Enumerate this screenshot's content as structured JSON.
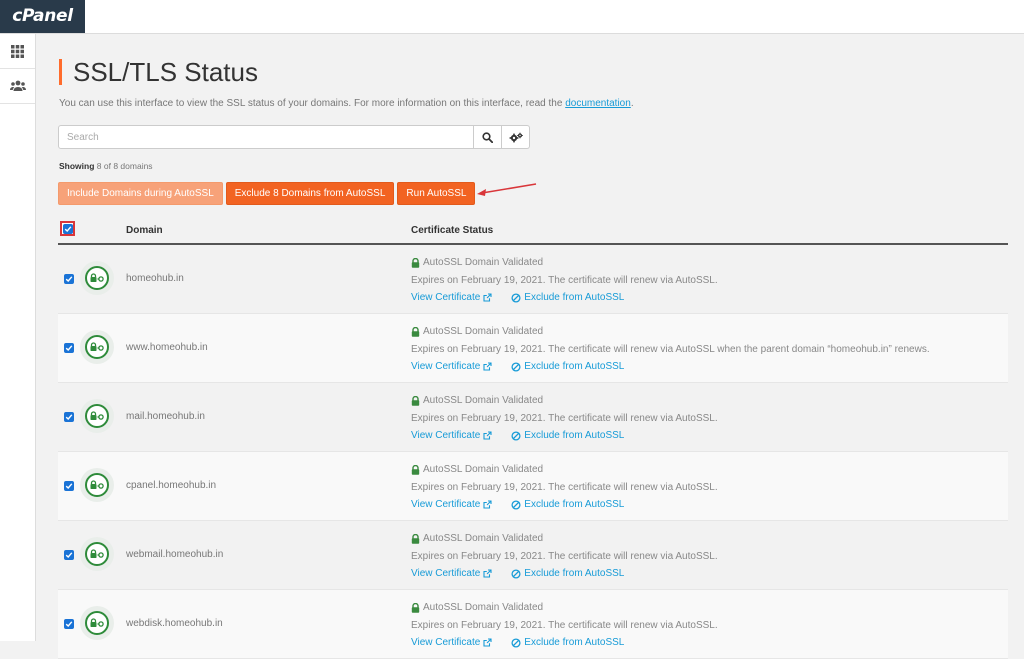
{
  "brand": {
    "logo_text": "cPanel"
  },
  "sidebar": {
    "items": [
      {
        "icon": "grid-icon"
      },
      {
        "icon": "users-icon"
      }
    ]
  },
  "page": {
    "title": "SSL/TLS Status",
    "description_prefix": "You can use this interface to view the SSL status of your domains. For more information on this interface, read the ",
    "description_link": "documentation",
    "description_suffix": "."
  },
  "search": {
    "placeholder": "Search",
    "value": ""
  },
  "showing": {
    "label": "Showing",
    "text": "8 of 8 domains"
  },
  "actions": {
    "include_label": "Include Domains during AutoSSL",
    "exclude_label": "Exclude 8 Domains from AutoSSL",
    "run_label": "Run AutoSSL"
  },
  "table": {
    "headers": {
      "domain": "Domain",
      "status": "Certificate Status"
    },
    "rows": [
      {
        "domain": "homeohub.in",
        "status": "AutoSSL Domain Validated",
        "expires": "Expires on February 19, 2021. The certificate will renew via AutoSSL.",
        "view": "View Certificate",
        "exclude": "Exclude from AutoSSL"
      },
      {
        "domain": "www.homeohub.in",
        "status": "AutoSSL Domain Validated",
        "expires": "Expires on February 19, 2021. The certificate will renew via AutoSSL when the parent domain “homeohub.in” renews.",
        "view": "View Certificate",
        "exclude": "Exclude from AutoSSL"
      },
      {
        "domain": "mail.homeohub.in",
        "status": "AutoSSL Domain Validated",
        "expires": "Expires on February 19, 2021. The certificate will renew via AutoSSL.",
        "view": "View Certificate",
        "exclude": "Exclude from AutoSSL"
      },
      {
        "domain": "cpanel.homeohub.in",
        "status": "AutoSSL Domain Validated",
        "expires": "Expires on February 19, 2021. The certificate will renew via AutoSSL.",
        "view": "View Certificate",
        "exclude": "Exclude from AutoSSL"
      },
      {
        "domain": "webmail.homeohub.in",
        "status": "AutoSSL Domain Validated",
        "expires": "Expires on February 19, 2021. The certificate will renew via AutoSSL.",
        "view": "View Certificate",
        "exclude": "Exclude from AutoSSL"
      },
      {
        "domain": "webdisk.homeohub.in",
        "status": "AutoSSL Domain Validated",
        "expires": "Expires on February 19, 2021. The certificate will renew via AutoSSL.",
        "view": "View Certificate",
        "exclude": "Exclude from AutoSSL"
      }
    ]
  },
  "colors": {
    "accent": "#ff6c2c",
    "button": "#f26322",
    "button_light": "#f7a279",
    "link": "#179bd7",
    "valid_green": "#2e8b3a",
    "annotation_red": "#d9363a"
  }
}
